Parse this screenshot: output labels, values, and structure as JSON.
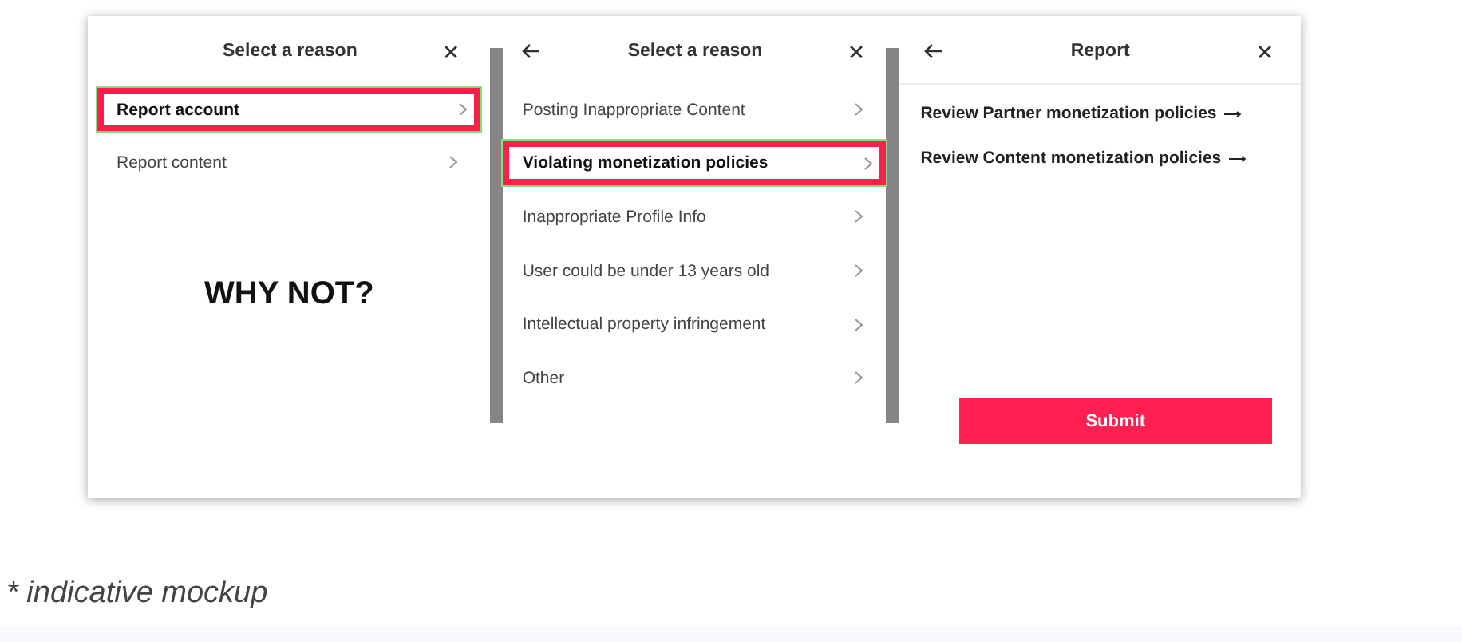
{
  "panels": [
    {
      "title": "Select a reason",
      "back": false,
      "close": true,
      "items": [
        {
          "label": "Report account",
          "highlighted": true
        },
        {
          "label": "Report content",
          "highlighted": false
        }
      ],
      "overlay_text": "WHY NOT?"
    },
    {
      "title": "Select a reason",
      "back": true,
      "close": true,
      "items": [
        {
          "label": "Posting Inappropriate Content",
          "highlighted": false
        },
        {
          "label": "Violating monetization policies",
          "highlighted": true
        },
        {
          "label": "Inappropriate Profile Info",
          "highlighted": false
        },
        {
          "label": "User could be under 13 years old",
          "highlighted": false
        },
        {
          "label": "Intellectual property infringement",
          "highlighted": false
        },
        {
          "label": "Other",
          "highlighted": false
        }
      ]
    },
    {
      "title": "Report",
      "back": true,
      "close": true,
      "links": [
        "Review Partner monetization policies",
        "Review Content monetization policies"
      ],
      "button": "Submit"
    }
  ],
  "caption": "* indicative mockup"
}
